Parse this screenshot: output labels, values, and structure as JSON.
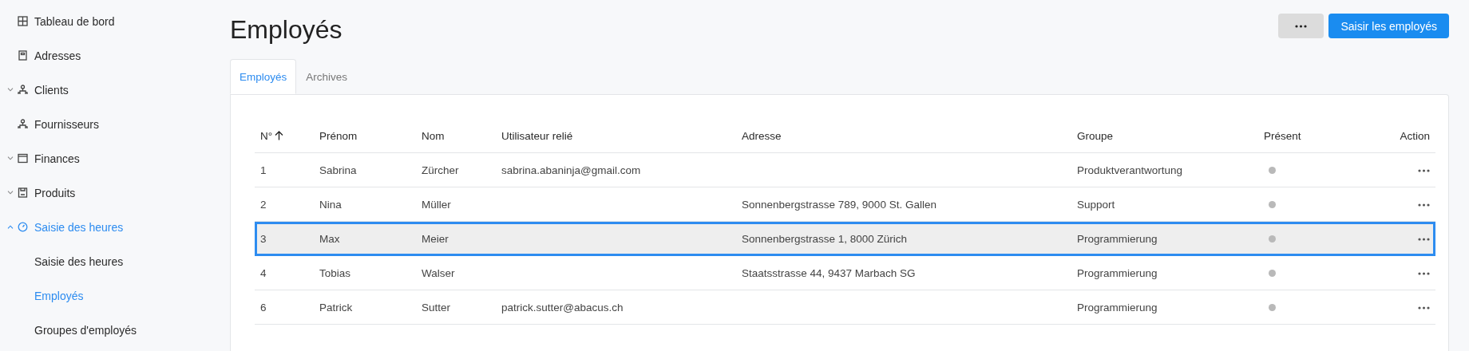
{
  "sidebar": {
    "items": [
      {
        "label": "Tableau de bord",
        "selected": false
      },
      {
        "label": "Adresses",
        "selected": false
      },
      {
        "label": "Clients",
        "expanded": false,
        "selected": false
      },
      {
        "label": "Fournisseurs",
        "selected": false
      },
      {
        "label": "Finances",
        "expanded": false,
        "selected": false
      },
      {
        "label": "Produits",
        "expanded": false,
        "selected": false
      },
      {
        "label": "Saisie des heures",
        "expanded": true,
        "selected": true,
        "children": [
          {
            "label": "Saisie des heures",
            "selected": false
          },
          {
            "label": "Employés",
            "selected": true
          },
          {
            "label": "Groupes d'employés",
            "selected": false
          }
        ]
      }
    ]
  },
  "page": {
    "title": "Employés",
    "primary_button": "Saisir les employés"
  },
  "tabs": [
    {
      "label": "Employés",
      "selected": true
    },
    {
      "label": "Archives",
      "selected": false
    }
  ],
  "table": {
    "columns": [
      {
        "label": "N°",
        "sorted_ascending": true
      },
      {
        "label": "Prénom"
      },
      {
        "label": "Nom"
      },
      {
        "label": "Utilisateur relié"
      },
      {
        "label": "Adresse"
      },
      {
        "label": "Groupe"
      },
      {
        "label": "Présent"
      },
      {
        "label": "Action"
      }
    ],
    "rows": [
      {
        "number": "1",
        "first_name": "Sabrina",
        "last_name": "Zürcher",
        "linked_user": "sabrina.abaninja@gmail.com",
        "group": "Produktverantwortung",
        "present": false,
        "selected": false
      },
      {
        "number": "2",
        "first_name": "Nina",
        "last_name": "Müller",
        "address": "Sonnenbergstrasse 789, 9000 St. Gallen",
        "group": "Support",
        "present": false,
        "selected": false
      },
      {
        "number": "3",
        "first_name": "Max",
        "last_name": "Meier",
        "address": "Sonnenbergstrasse 1, 8000 Zürich",
        "group": "Programmierung",
        "present": false,
        "selected": true
      },
      {
        "number": "4",
        "first_name": "Tobias",
        "last_name": "Walser",
        "address": "Staatsstrasse 44, 9437 Marbach SG",
        "group": "Programmierung",
        "present": false,
        "selected": false
      },
      {
        "number": "6",
        "first_name": "Patrick",
        "last_name": "Sutter",
        "linked_user": "patrick.sutter@abacus.ch",
        "group": "Programmierung",
        "present": false,
        "selected": false
      }
    ]
  }
}
